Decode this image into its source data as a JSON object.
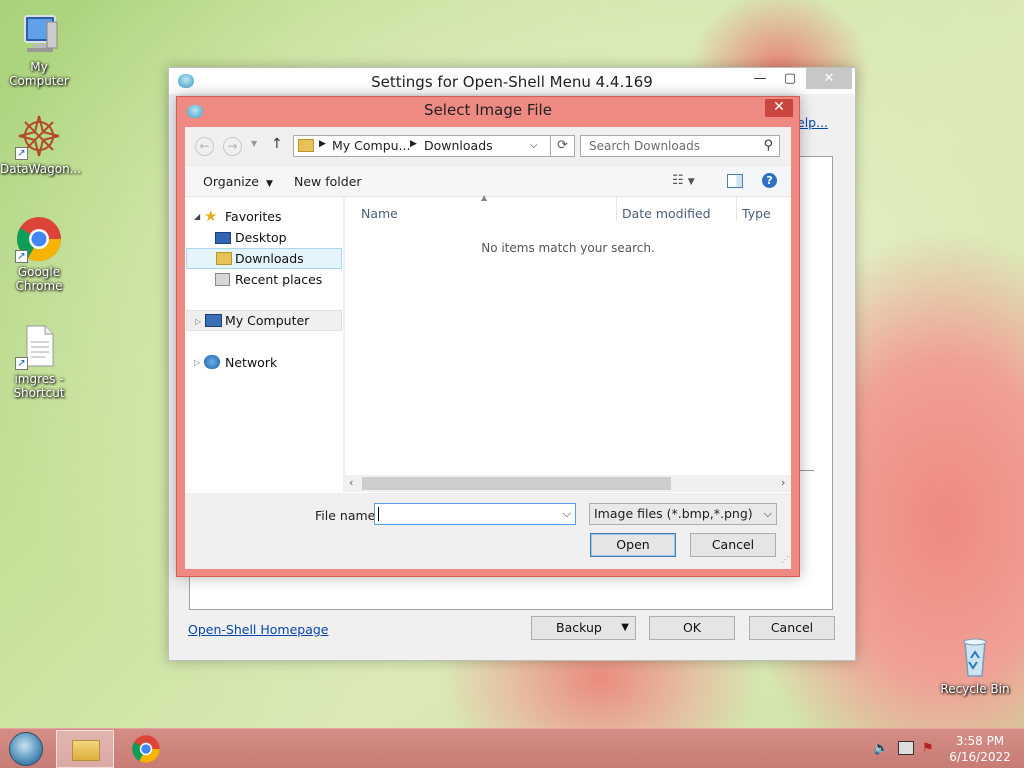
{
  "desktop": {
    "icons": [
      {
        "label": "My Computer",
        "icon": "computer-icon"
      },
      {
        "label": "DataWagon...",
        "icon": "datawagon-icon"
      },
      {
        "label": "Google Chrome",
        "icon": "chrome-icon"
      },
      {
        "label": "imgres - Shortcut",
        "icon": "file-icon"
      },
      {
        "label": "Recycle Bin",
        "icon": "recycle-bin-icon"
      }
    ]
  },
  "settings_window": {
    "title": "Settings for Open-Shell Menu 4.4.169",
    "help_link": "elp...",
    "homepage_link": "Open-Shell Homepage",
    "backup_label": "Backup",
    "ok_label": "OK",
    "cancel_label": "Cancel"
  },
  "dialog": {
    "title": "Select Image File",
    "breadcrumb": [
      "My Compu...",
      "Downloads"
    ],
    "search_placeholder": "Search Downloads",
    "toolbar": {
      "organize": "Organize",
      "new_folder": "New folder"
    },
    "nav": {
      "favorites": "Favorites",
      "favorites_items": [
        "Desktop",
        "Downloads",
        "Recent places"
      ],
      "my_computer": "My Computer",
      "network": "Network",
      "selected": "Downloads"
    },
    "columns": [
      "Name",
      "Date modified",
      "Type"
    ],
    "empty_message": "No items match your search.",
    "file_name_label": "File name:",
    "file_name_value": "",
    "file_type_value": "Image files (*.bmp,*.png)",
    "open_label": "Open",
    "cancel_label": "Cancel"
  },
  "taskbar": {
    "time": "3:58 PM",
    "date": "6/16/2022"
  },
  "colors": {
    "accent": "#ef8a82",
    "taskbar": "#cc827c"
  }
}
